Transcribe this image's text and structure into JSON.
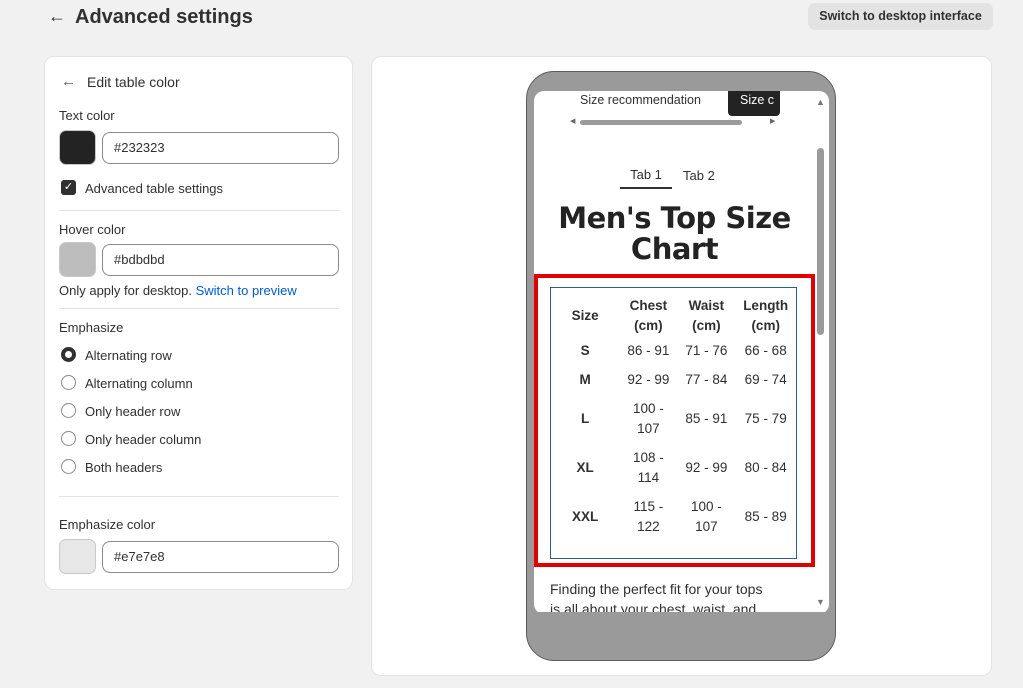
{
  "header": {
    "back_icon": "arrow-left-icon",
    "title": "Advanced settings",
    "switch_desktop_label": "Switch to desktop interface"
  },
  "left_panel": {
    "back_icon": "arrow-left-icon",
    "title": "Edit table color",
    "text_color": {
      "label": "Text color",
      "value": "#232323",
      "swatch": "#232323"
    },
    "advanced_checkbox": {
      "label": "Advanced table settings",
      "checked": true
    },
    "hover_color": {
      "label": "Hover color",
      "value": "#bdbdbd",
      "swatch": "#bdbdbd"
    },
    "hover_note": "Only apply for desktop.",
    "hover_link": "Switch to preview",
    "emphasize": {
      "label": "Emphasize",
      "options": [
        "Alternating row",
        "Alternating column",
        "Only header row",
        "Only header column",
        "Both headers"
      ],
      "selected": "Alternating row"
    },
    "emphasize_color": {
      "label": "Emphasize color",
      "value": "#e7e7e8",
      "swatch": "#e7e7e8"
    }
  },
  "preview": {
    "top_tabs": [
      "Size recommendation",
      "Size c"
    ],
    "inner_tabs": [
      "Tab 1",
      "Tab 2"
    ],
    "chart_title_line1": "Men's Top Size",
    "chart_title_line2": "Chart",
    "table": {
      "headers": [
        [
          "Size"
        ],
        [
          "Chest",
          "(cm)"
        ],
        [
          "Waist",
          "(cm)"
        ],
        [
          "Length",
          "(cm)"
        ]
      ],
      "rows": [
        [
          [
            "S"
          ],
          [
            "86 - 91"
          ],
          [
            "71 - 76"
          ],
          [
            "66 - 68"
          ]
        ],
        [
          [
            "M"
          ],
          [
            "92 - 99"
          ],
          [
            "77 - 84"
          ],
          [
            "69 - 74"
          ]
        ],
        [
          [
            "L"
          ],
          [
            "100 -",
            "107"
          ],
          [
            "85 - 91"
          ],
          [
            "75 - 79"
          ]
        ],
        [
          [
            "XL"
          ],
          [
            "108 -",
            "114"
          ],
          [
            "92 - 99"
          ],
          [
            "80 - 84"
          ]
        ],
        [
          [
            "XXL"
          ],
          [
            "115 -",
            "122"
          ],
          [
            "100 -",
            "107"
          ],
          [
            "85 - 89"
          ]
        ]
      ]
    },
    "description_line1": "Finding the perfect fit for your tops",
    "description_line2": "is all about your chest, waist, and"
  }
}
